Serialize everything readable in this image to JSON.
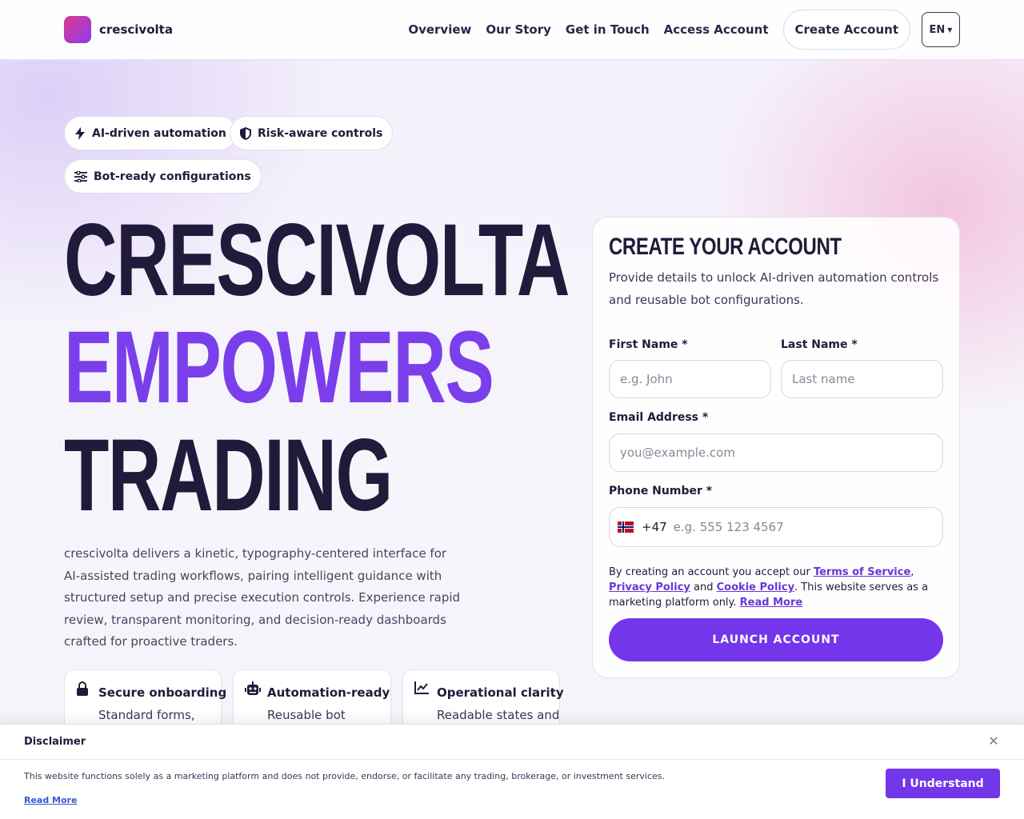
{
  "header": {
    "brand": "crescivolta",
    "nav": [
      "Overview",
      "Our Story",
      "Get in Touch",
      "Access Account"
    ],
    "create_account": "Create Account",
    "language": "EN"
  },
  "chips": [
    "AI-driven automation",
    "Risk-aware controls",
    "Bot-ready configurations"
  ],
  "hero": {
    "line1": "CRESCIVOLTA",
    "line2": "EMPOWERS",
    "line3": "TRADING",
    "description": "crescivolta delivers a kinetic, typography-centered interface for AI-assisted trading workflows, pairing intelligent guidance with structured setup and precise execution controls. Experience rapid review, transparent monitoring, and decision-ready dashboards crafted for proactive traders."
  },
  "features": [
    {
      "title": "Secure onboarding",
      "subtitle": "Standard forms,",
      "icon": "lock-icon"
    },
    {
      "title": "Automation-ready",
      "subtitle": "Reusable bot",
      "icon": "robot-icon"
    },
    {
      "title": "Operational clarity",
      "subtitle": "Readable states and",
      "icon": "chart-line-icon"
    }
  ],
  "form": {
    "title": "CREATE YOUR ACCOUNT",
    "subtitle": "Provide details to unlock AI-driven automation controls and reusable bot configurations.",
    "first_name_label": "First Name *",
    "first_name_placeholder": "e.g. John",
    "last_name_label": "Last Name *",
    "last_name_placeholder": "Last name",
    "email_label": "Email Address *",
    "email_placeholder": "you@example.com",
    "phone_label": "Phone Number *",
    "phone_code": "+47",
    "phone_placeholder": "e.g. 555 123 4567",
    "legal_prefix": "By creating an account you accept our ",
    "terms": "Terms of Service",
    "comma": ", ",
    "privacy": "Privacy Policy",
    "and": " and ",
    "cookie": "Cookie Policy",
    "legal_suffix": ". This website serves as a marketing platform only. ",
    "read_more": "Read More",
    "submit": "LAUNCH ACCOUNT"
  },
  "disclaimer": {
    "title": "Disclaimer",
    "text": "This website functions solely as a marketing platform and does not provide, endorse, or facilitate any trading, brokerage, or investment services.",
    "read_more": "Read More",
    "button": "I Understand"
  },
  "colors": {
    "accent": "#7336ea",
    "heading_dark": "#221a3a",
    "headline_purple": "#7a3fea"
  }
}
